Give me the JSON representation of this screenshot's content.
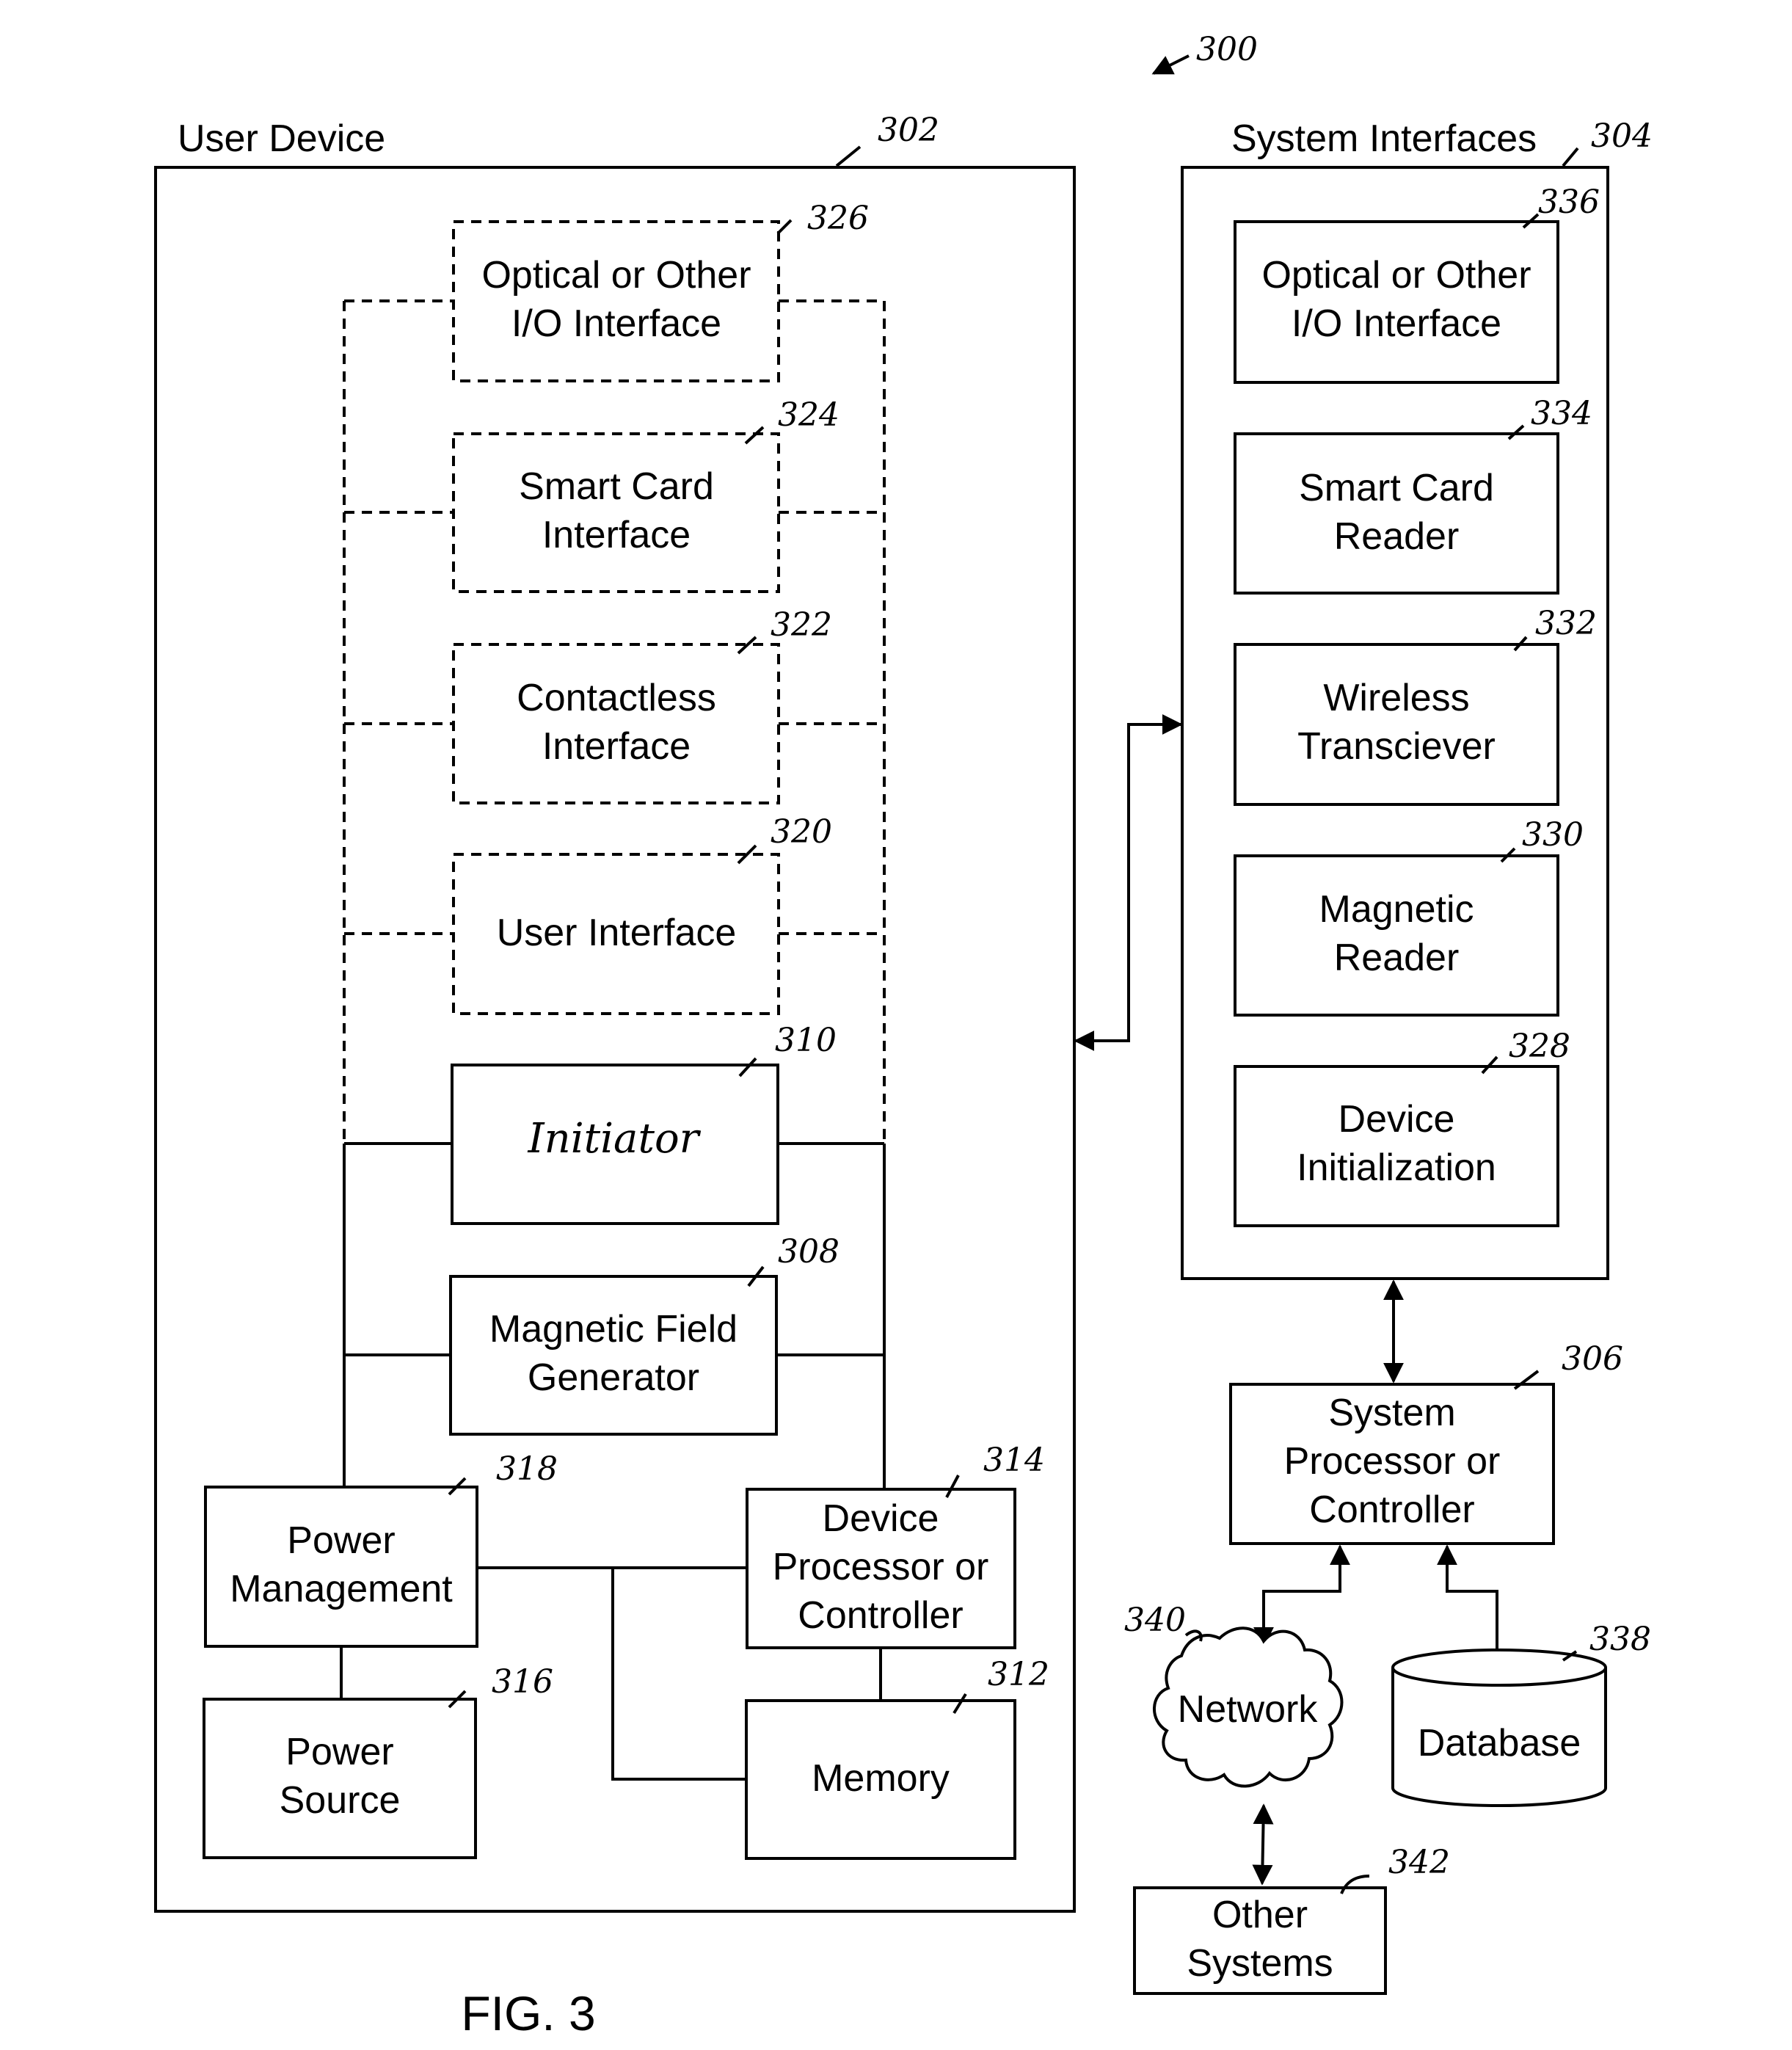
{
  "figure": {
    "ref": "300",
    "caption": "FIG. 3"
  },
  "user_device": {
    "title": "User Device",
    "ref": "302",
    "optional_interfaces": [
      {
        "lines": [
          "Optical or Other",
          "I/O Interface"
        ],
        "ref": "326"
      },
      {
        "lines": [
          "Smart Card",
          "Interface"
        ],
        "ref": "324"
      },
      {
        "lines": [
          "Contactless",
          "Interface"
        ],
        "ref": "322"
      },
      {
        "lines": [
          "User Interface"
        ],
        "ref": "320"
      }
    ],
    "initiator": {
      "lines": [
        "Initiator"
      ],
      "ref": "310"
    },
    "magnetic_field_generator": {
      "lines": [
        "Magnetic Field",
        "Generator"
      ],
      "ref": "308"
    },
    "power_management": {
      "lines": [
        "Power",
        "Management"
      ],
      "ref": "318"
    },
    "power_source": {
      "lines": [
        "Power",
        "Source"
      ],
      "ref": "316"
    },
    "device_processor": {
      "lines": [
        "Device",
        "Processor or",
        "Controller"
      ],
      "ref": "314"
    },
    "memory": {
      "lines": [
        "Memory"
      ],
      "ref": "312"
    }
  },
  "system_interfaces": {
    "title": "System Interfaces",
    "ref": "304",
    "items": [
      {
        "lines": [
          "Optical or Other",
          "I/O Interface"
        ],
        "ref": "336"
      },
      {
        "lines": [
          "Smart Card",
          "Reader"
        ],
        "ref": "334"
      },
      {
        "lines": [
          "Wireless",
          "Transciever"
        ],
        "ref": "332"
      },
      {
        "lines": [
          "Magnetic",
          "Reader"
        ],
        "ref": "330"
      },
      {
        "lines": [
          "Device",
          "Initialization"
        ],
        "ref": "328"
      }
    ]
  },
  "system_processor": {
    "lines": [
      "System",
      "Processor or",
      "Controller"
    ],
    "ref": "306"
  },
  "network": {
    "label": "Network",
    "ref": "340"
  },
  "database": {
    "label": "Database",
    "ref": "338"
  },
  "other_systems": {
    "lines": [
      "Other",
      "Systems"
    ],
    "ref": "342"
  }
}
